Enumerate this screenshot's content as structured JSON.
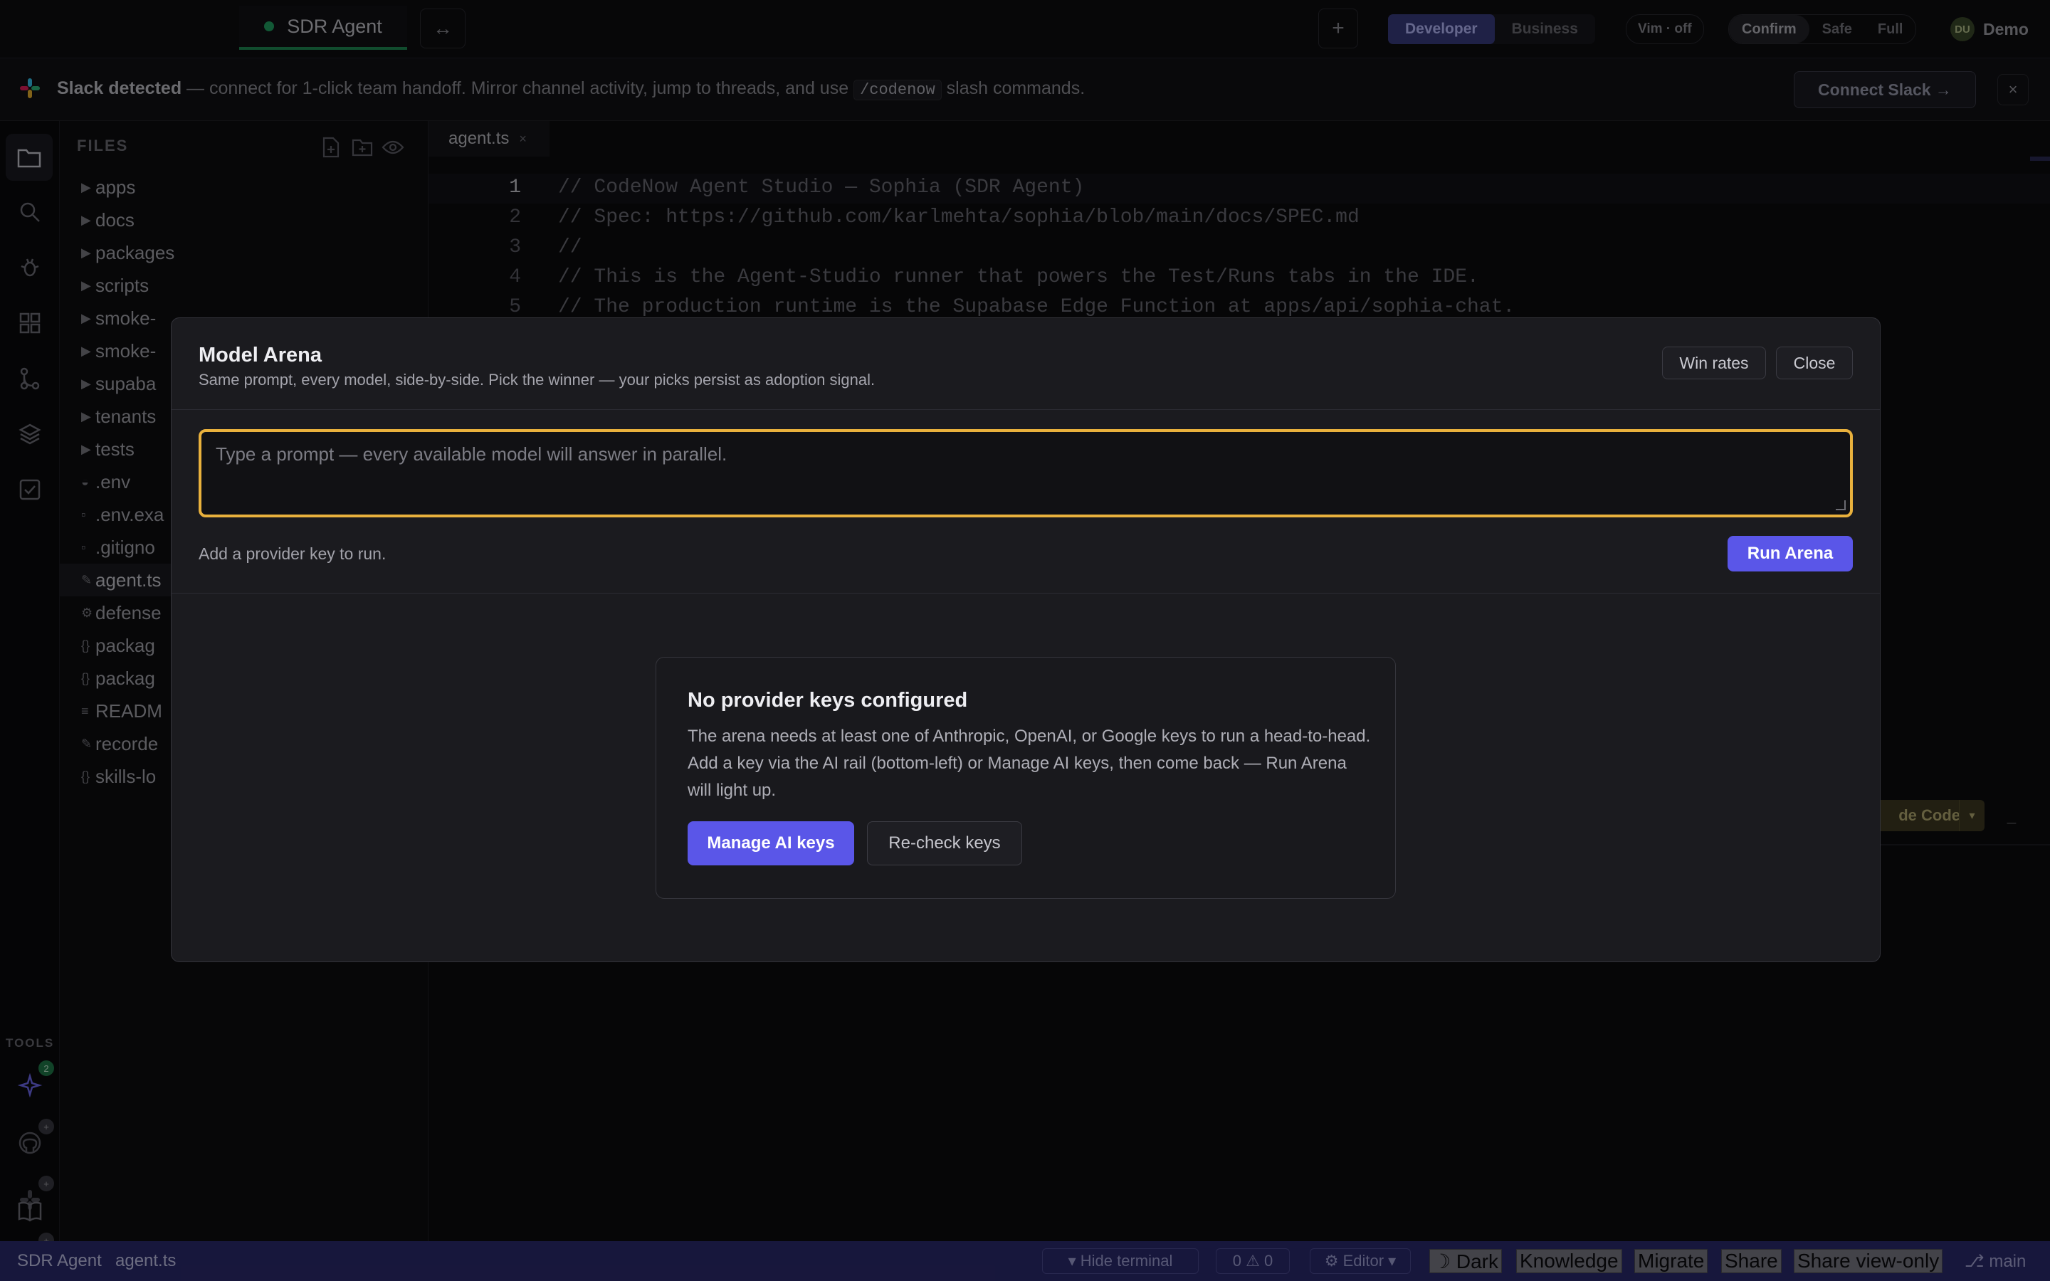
{
  "topbar": {
    "tab_label": "SDR Agent",
    "swap_icon": "↔",
    "plus_icon": "+",
    "mode_developer": "Developer",
    "mode_business": "Business",
    "vim": "Vim · off",
    "perm_confirm": "Confirm",
    "perm_safe": "Safe",
    "perm_full": "Full",
    "avatar_initials": "DU",
    "user_name": "Demo"
  },
  "banner": {
    "title": "Slack detected",
    "text_before": " — connect for 1-click team handoff. Mirror channel activity, jump to threads, and use ",
    "command": "/codenow",
    "text_after": " slash commands.",
    "connect_label": "Connect Slack →",
    "close_icon": "×"
  },
  "sidebar": {
    "tools_label": "TOOLS",
    "sparkle_badge": "2",
    "github_badge": "+",
    "slack_badge": "+",
    "diamond_badge": "+"
  },
  "explorer": {
    "title": "FILES",
    "items": [
      {
        "icon": "▶",
        "name": "apps"
      },
      {
        "icon": "▶",
        "name": "docs"
      },
      {
        "icon": "▶",
        "name": "packages"
      },
      {
        "icon": "▶",
        "name": "scripts"
      },
      {
        "icon": "▶",
        "name": "smoke-"
      },
      {
        "icon": "▶",
        "name": "smoke-"
      },
      {
        "icon": "▶",
        "name": "supaba"
      },
      {
        "icon": "▶",
        "name": "tenants"
      },
      {
        "icon": "▶",
        "name": "tests"
      },
      {
        "icon": "◒",
        "name": ".env"
      },
      {
        "icon": "▫",
        "name": ".env.exa"
      },
      {
        "icon": "▫",
        "name": ".gitigno"
      },
      {
        "icon": "✎",
        "name": "agent.ts"
      },
      {
        "icon": "⚙",
        "name": "defense"
      },
      {
        "icon": "{}",
        "name": "packag"
      },
      {
        "icon": "{}",
        "name": "packag"
      },
      {
        "icon": "≡",
        "name": "READM"
      },
      {
        "icon": "✎",
        "name": "recorde"
      },
      {
        "icon": "{}",
        "name": "skills-lo"
      }
    ]
  },
  "editor": {
    "tab_name": "agent.ts",
    "tab_close": "×",
    "lines": [
      {
        "n": "1",
        "text": "// CodeNow Agent Studio — Sophia (SDR Agent)"
      },
      {
        "n": "2",
        "text": "// Spec: https://github.com/karlmehta/sophia/blob/main/docs/SPEC.md"
      },
      {
        "n": "3",
        "text": "//"
      },
      {
        "n": "4",
        "text": "// This is the Agent-Studio runner that powers the Test/Runs tabs in the IDE."
      },
      {
        "n": "5",
        "text": "// The production runtime is the Supabase Edge Function at apps/api/sophia-chat."
      }
    ],
    "claude_code_label": "de Code",
    "claude_dropdown": "▾",
    "minimize": "_"
  },
  "modal": {
    "title": "Model Arena",
    "subtitle": "Same prompt, every model, side-by-side. Pick the winner — your picks persist as adoption signal.",
    "win_rates": "Win rates",
    "close": "Close",
    "prompt_placeholder": "Type a prompt — every available model will answer in parallel.",
    "prompt_value": "",
    "hint": "Add a provider key to run.",
    "run_label": "Run Arena",
    "empty": {
      "title": "No provider keys configured",
      "body": "The arena needs at least one of Anthropic, OpenAI, or Google keys to run a head-to-head. Add a key via the AI rail (bottom-left) or Manage AI keys, then come back — Run Arena will light up.",
      "manage_label": "Manage AI keys",
      "recheck_label": "Re-check keys"
    }
  },
  "statusbar": {
    "project": "SDR Agent",
    "file": "agent.ts",
    "hide_terminal": "▾ Hide terminal",
    "problems": "0 ⚠ 0",
    "editor_mode": "⚙ Editor ▾",
    "theme": "☽ Dark",
    "knowledge": "Knowledge",
    "migrate": "Migrate",
    "share": "Share",
    "share_view_only": "Share view-only",
    "branch": "⎇ main"
  },
  "colors": {
    "accent": "#5a56e8",
    "focus_ring": "#e9b13d",
    "status_bar": "#2b2a6e",
    "active_tab_indicator": "#22a363"
  }
}
